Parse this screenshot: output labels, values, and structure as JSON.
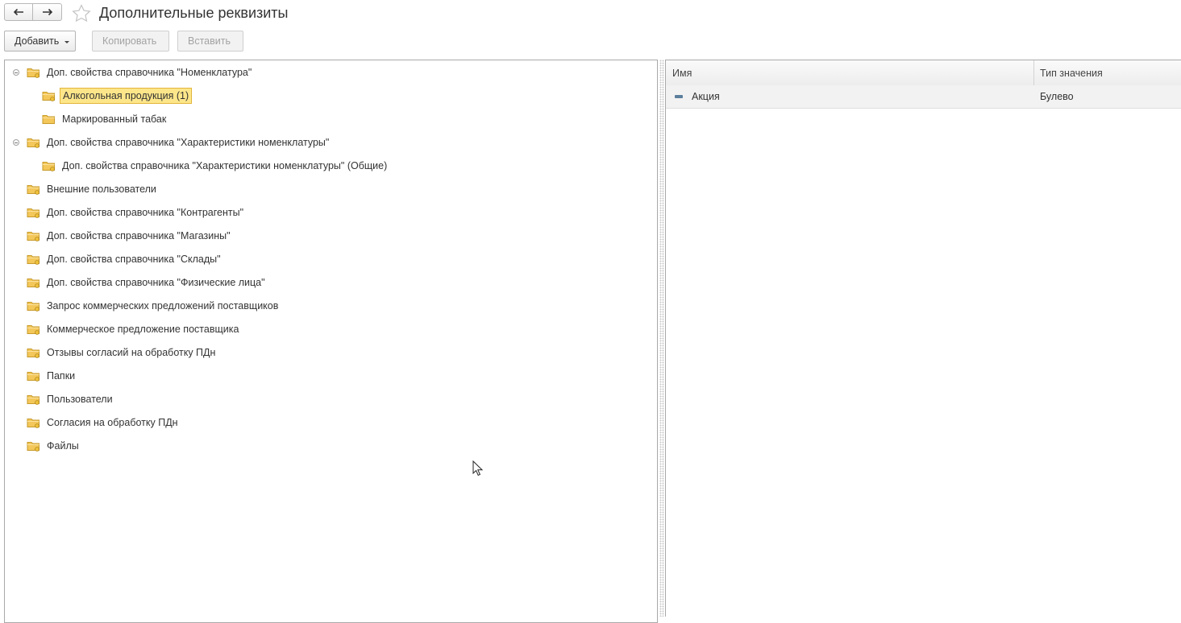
{
  "window": {
    "title": "Дополнительные реквизиты"
  },
  "toolbar": {
    "add_label": "Добавить",
    "copy_label": "Копировать",
    "paste_label": "Вставить"
  },
  "tree": {
    "items": [
      {
        "label": "Доп. свойства справочника \"Номенклатура\"",
        "level": 0,
        "expanded": true
      },
      {
        "label": "Алкогольная продукция (1)",
        "level": 1,
        "selected": true
      },
      {
        "label": "Маркированный табак",
        "level": 1
      },
      {
        "label": "Доп. свойства справочника \"Характеристики номенклатуры\"",
        "level": 0,
        "expanded": true
      },
      {
        "label": "Доп. свойства справочника \"Характеристики номенклатуры\" (Общие)",
        "level": 1
      },
      {
        "label": "Внешние пользователи",
        "level": 0
      },
      {
        "label": "Доп. свойства справочника \"Контрагенты\"",
        "level": 0
      },
      {
        "label": "Доп. свойства справочника \"Магазины\"",
        "level": 0
      },
      {
        "label": "Доп. свойства справочника \"Склады\"",
        "level": 0
      },
      {
        "label": "Доп. свойства справочника \"Физические лица\"",
        "level": 0
      },
      {
        "label": "Запрос коммерческих предложений поставщиков",
        "level": 0
      },
      {
        "label": "Коммерческое предложение поставщика",
        "level": 0
      },
      {
        "label": "Отзывы согласий на обработку ПДн",
        "level": 0
      },
      {
        "label": "Папки",
        "level": 0
      },
      {
        "label": "Пользователи",
        "level": 0
      },
      {
        "label": "Согласия на обработку ПДн",
        "level": 0
      },
      {
        "label": "Файлы",
        "level": 0
      }
    ]
  },
  "grid": {
    "columns": [
      "Имя",
      "Тип значения"
    ],
    "rows": [
      {
        "name": "Акция",
        "type": "Булево"
      }
    ]
  },
  "colors": {
    "selection_fill": "#fde68a",
    "selection_border": "#e2b53c",
    "folder": "#f3c75a"
  }
}
